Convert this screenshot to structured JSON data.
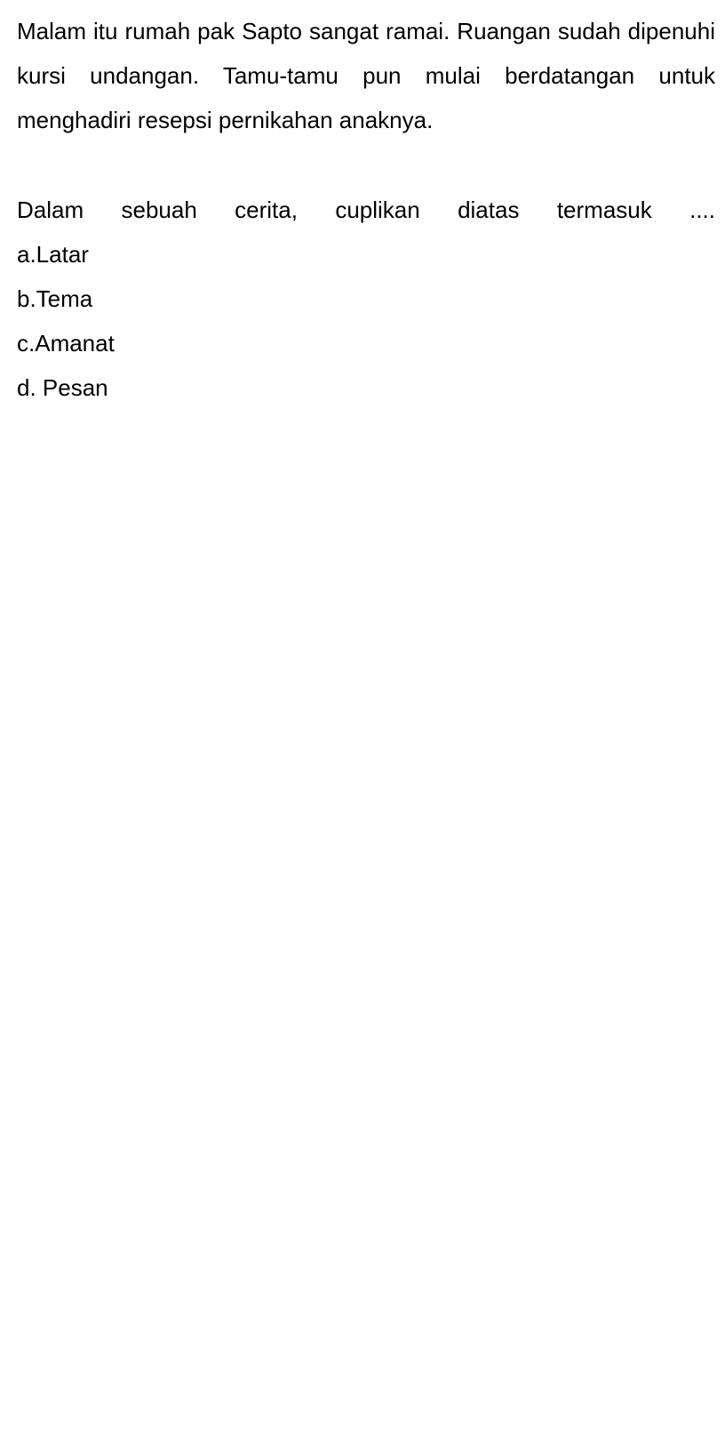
{
  "passage": "Malam itu rumah pak Sapto sangat ramai. Ruangan sudah dipenuhi kursi undangan. Tamu-tamu pun mulai berdatangan untuk menghadiri resepsi pernikahan anaknya.",
  "question": "Dalam sebuah cerita, cuplikan diatas termasuk ....",
  "options": [
    "a.Latar",
    "b.Tema",
    "c.Amanat",
    "d. Pesan"
  ]
}
